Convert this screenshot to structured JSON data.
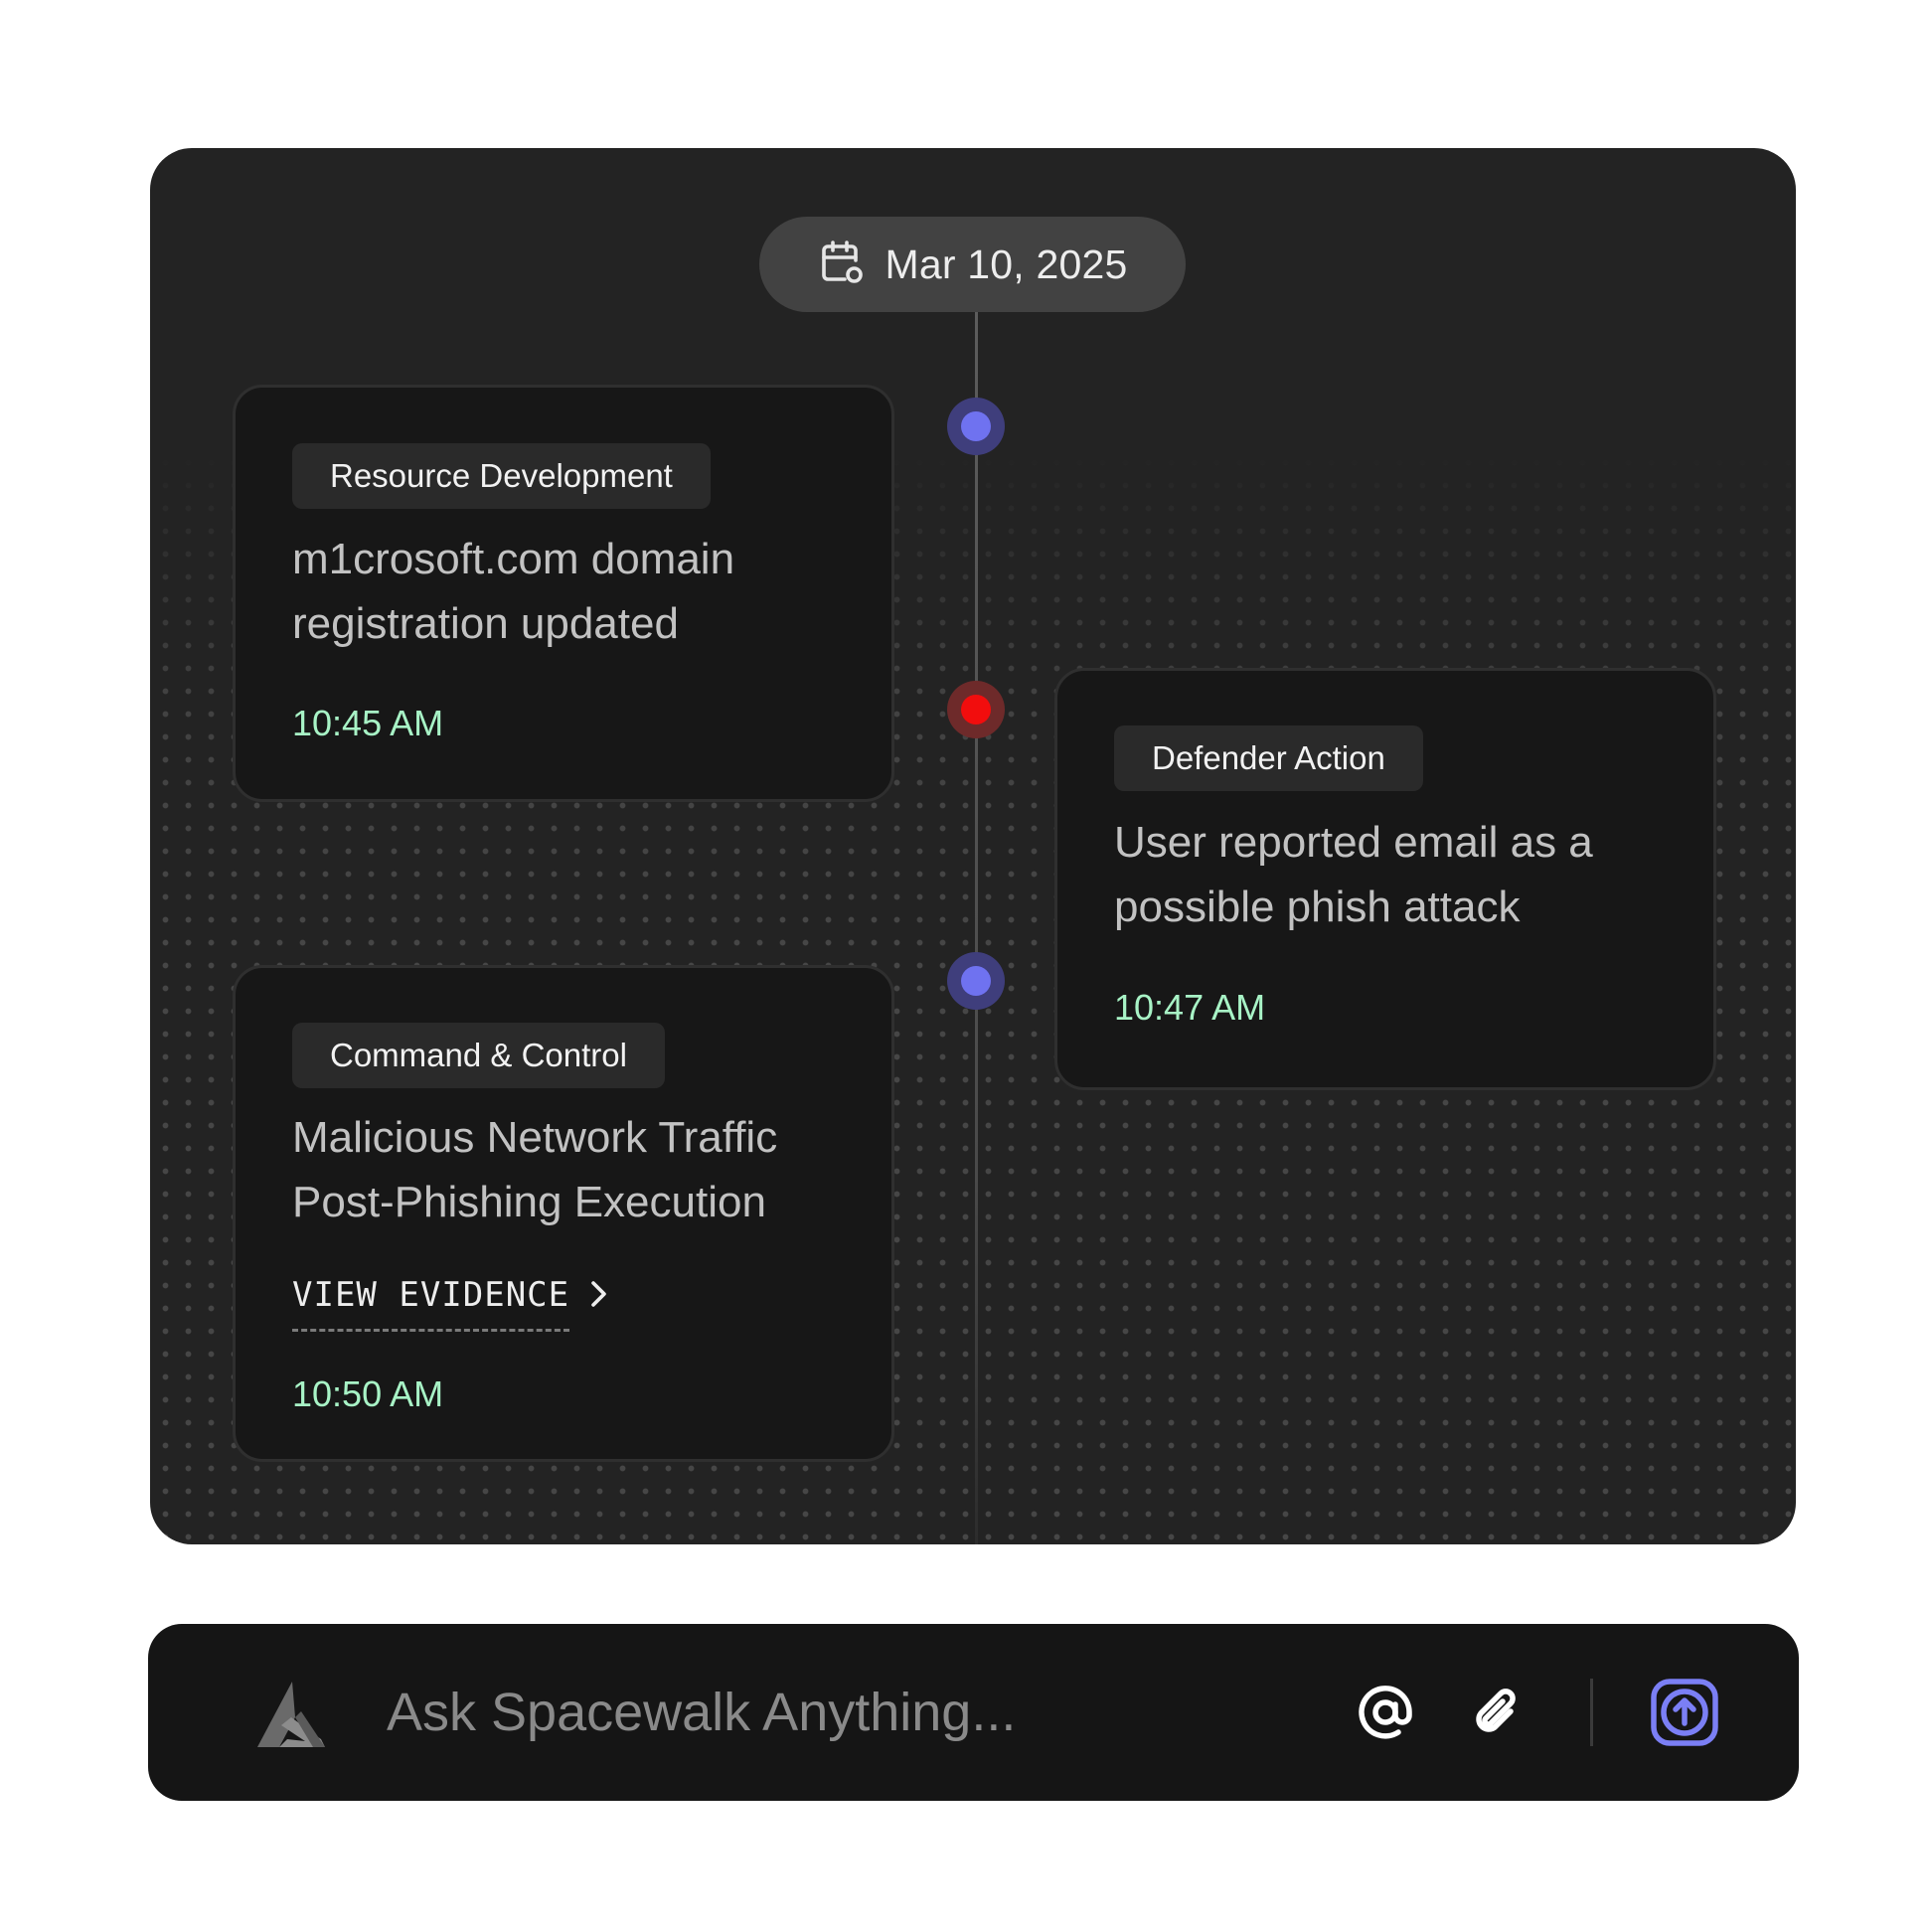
{
  "timeline": {
    "date": "Mar 10, 2025",
    "icons": {
      "date": "calendar-clock-icon"
    },
    "colors": {
      "node_blue": "#6f72f0",
      "node_red": "#f20d0d",
      "time_green": "#a8f3c6"
    },
    "events": [
      {
        "tag": "Resource Development",
        "title_line1": "m1crosoft.com domain",
        "title_line2": "registration updated",
        "time": "10:45 AM",
        "node": "blue"
      },
      {
        "tag": "Defender Action",
        "title_line1": "User reported email as a",
        "title_line2": "possible phish attack",
        "time": "10:47 AM",
        "node": "red"
      },
      {
        "tag": "Command & Control",
        "title_line1": "Malicious Network Traffic",
        "title_line2": "Post-Phishing Execution",
        "link_label": "VIEW EVIDENCE",
        "link_icon": "chevron-right-icon",
        "time": "10:50 AM",
        "node": "blue"
      }
    ]
  },
  "chat": {
    "placeholder": "Ask Spacewalk Anything...",
    "icons": {
      "logo": "spacewalk-logo-icon",
      "mention": "at-sign-icon",
      "attach": "paperclip-icon",
      "send": "arrow-up-icon"
    },
    "accent": "#7b7ff5"
  }
}
